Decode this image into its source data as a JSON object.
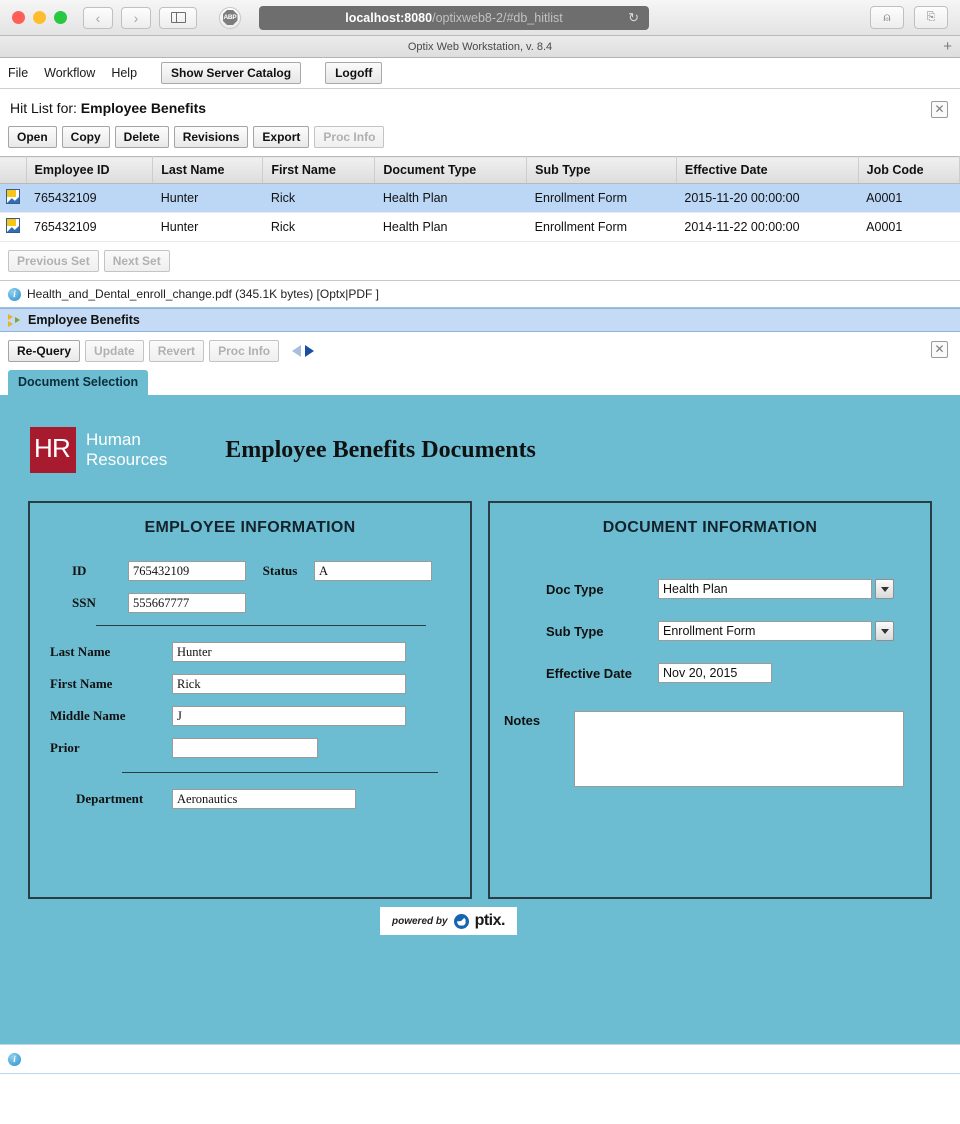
{
  "browser": {
    "url_host": "localhost:8080",
    "url_path": "/optixweb8-2/#db_hitlist",
    "reload_icon": "reload-icon",
    "back_icon": "‹",
    "forward_icon": "›",
    "sidebar_icon": "sidebar-icon",
    "extension_label": "ABP",
    "share_icon": "⇧",
    "tabs_icon": "❐",
    "new_tab_label": "+"
  },
  "app": {
    "window_title": "Optix Web Workstation, v. 8.4",
    "menu": [
      "File",
      "Workflow",
      "Help"
    ],
    "buttons": {
      "server_catalog": "Show Server Catalog",
      "logoff": "Logoff"
    }
  },
  "hitlist": {
    "title_prefix": "Hit List for:",
    "title_name": "Employee Benefits",
    "close_label": "✕",
    "toolbar": [
      {
        "label": "Open",
        "disabled": false
      },
      {
        "label": "Copy",
        "disabled": false
      },
      {
        "label": "Delete",
        "disabled": false
      },
      {
        "label": "Revisions",
        "disabled": false
      },
      {
        "label": "Export",
        "disabled": false
      },
      {
        "label": "Proc Info",
        "disabled": true
      }
    ],
    "columns": [
      "Employee ID",
      "Last Name",
      "First Name",
      "Document Type",
      "Sub Type",
      "Effective Date",
      "Job Code"
    ],
    "rows": [
      {
        "selected": true,
        "employee_id": "765432109",
        "last_name": "Hunter",
        "first_name": "Rick",
        "document_type": "Health Plan",
        "sub_type": "Enrollment Form",
        "effective_date": "2015-11-20 00:00:00",
        "job_code": "A0001"
      },
      {
        "selected": false,
        "employee_id": "765432109",
        "last_name": "Hunter",
        "first_name": "Rick",
        "document_type": "Health Plan",
        "sub_type": "Enrollment Form",
        "effective_date": "2014-11-22 00:00:00",
        "job_code": "A0001"
      }
    ],
    "pager": [
      {
        "label": "Previous Set",
        "disabled": true
      },
      {
        "label": "Next Set",
        "disabled": true
      }
    ],
    "status_text": "Health_and_Dental_enroll_change.pdf (345.1K bytes) [Optx|PDF ]"
  },
  "docpanel": {
    "header_title": "Employee Benefits",
    "close_label": "✕",
    "toolbar": [
      {
        "label": "Re-Query",
        "disabled": false
      },
      {
        "label": "Update",
        "disabled": true
      },
      {
        "label": "Revert",
        "disabled": true
      },
      {
        "label": "Proc Info",
        "disabled": true
      }
    ],
    "tab_label": "Document Selection"
  },
  "form": {
    "logo_line1": "Human",
    "logo_line2": "Resources",
    "logo_mark": "HR",
    "title": "Employee Benefits Documents",
    "employee": {
      "card_title": "EMPLOYEE INFORMATION",
      "id_label": "ID",
      "id_value": "765432109",
      "status_label": "Status",
      "status_value": "A",
      "ssn_label": "SSN",
      "ssn_value": "555667777",
      "last_name_label": "Last Name",
      "last_name_value": "Hunter",
      "first_name_label": "First Name",
      "first_name_value": "Rick",
      "middle_name_label": "Middle Name",
      "middle_name_value": "J",
      "prior_label": "Prior",
      "prior_value": "",
      "department_label": "Department",
      "department_value": "Aeronautics"
    },
    "document": {
      "card_title": "DOCUMENT INFORMATION",
      "doc_type_label": "Doc Type",
      "doc_type_value": "Health Plan",
      "sub_type_label": "Sub Type",
      "sub_type_value": "Enrollment Form",
      "effective_date_label": "Effective Date",
      "effective_date_value": "Nov 20, 2015",
      "notes_label": "Notes",
      "notes_value": ""
    },
    "footer": {
      "powered_by": "powered by",
      "brand": "ptix."
    }
  },
  "colors": {
    "teal": "#6CBDD2",
    "selection_blue": "#bcd7f5",
    "panel_header_blue": "#c4daf5",
    "hr_red": "#a81b2e",
    "optix_blue": "#1565b0"
  }
}
